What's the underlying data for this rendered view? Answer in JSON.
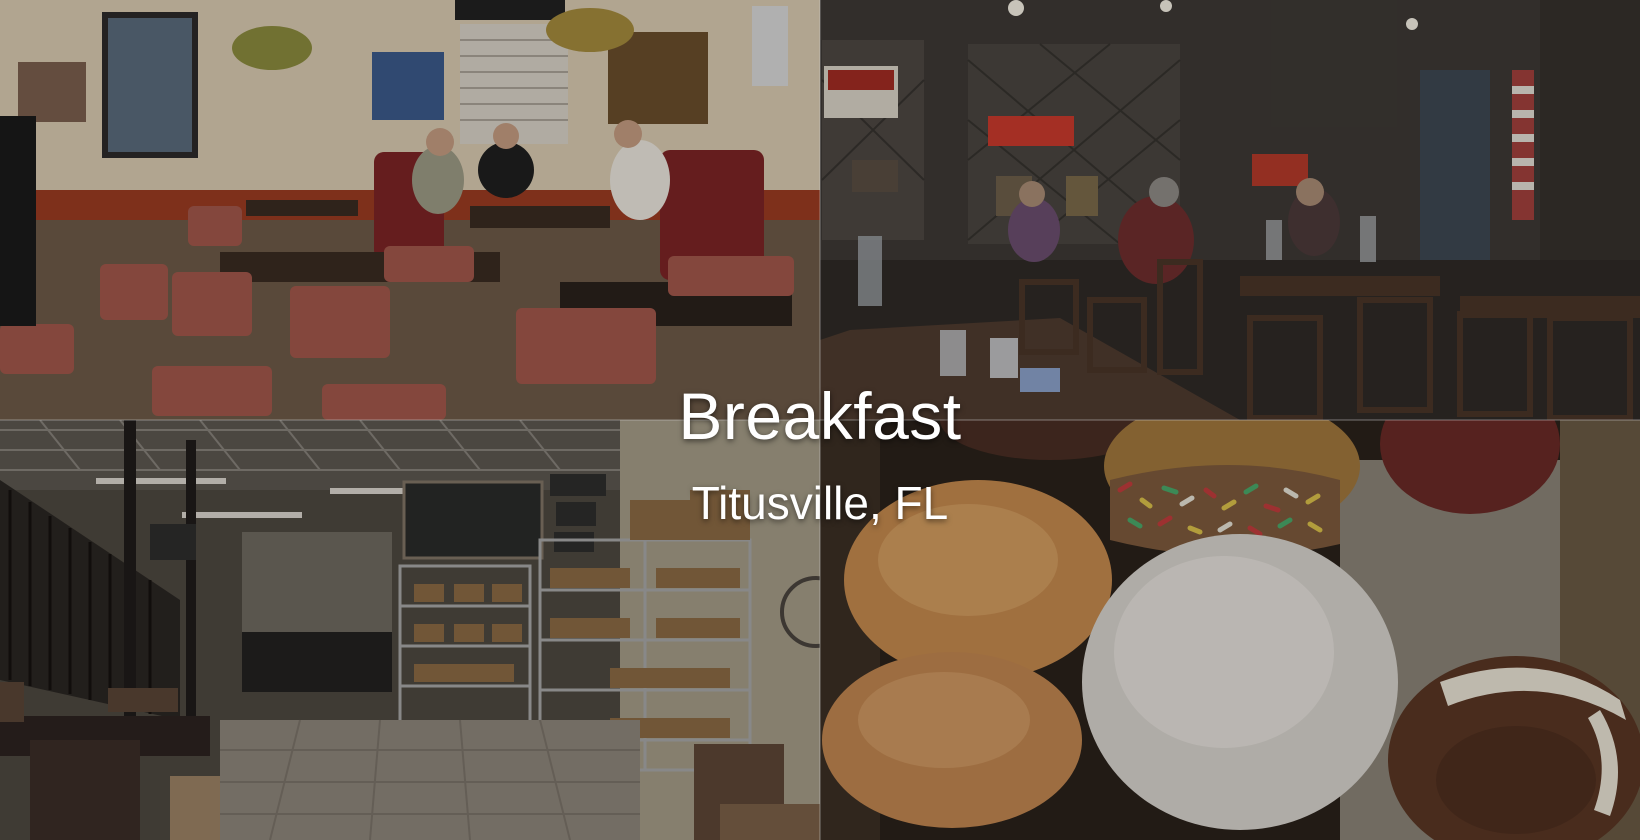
{
  "hero": {
    "title": "Breakfast",
    "subtitle": "Titusville, FL"
  },
  "photos": [
    {
      "name": "diner-booths",
      "position": "top-left"
    },
    {
      "name": "country-store-dining",
      "position": "top-right"
    },
    {
      "name": "bakery-shelves",
      "position": "bottom-left"
    },
    {
      "name": "donut-box",
      "position": "bottom-right"
    }
  ],
  "colors": {
    "overlay_text": "#ffffff",
    "diner_wall": "#d9cbb2",
    "booth_red": "#8c2f2a",
    "store_wood": "#4b3628",
    "donut_glaze": "#c98e52"
  }
}
